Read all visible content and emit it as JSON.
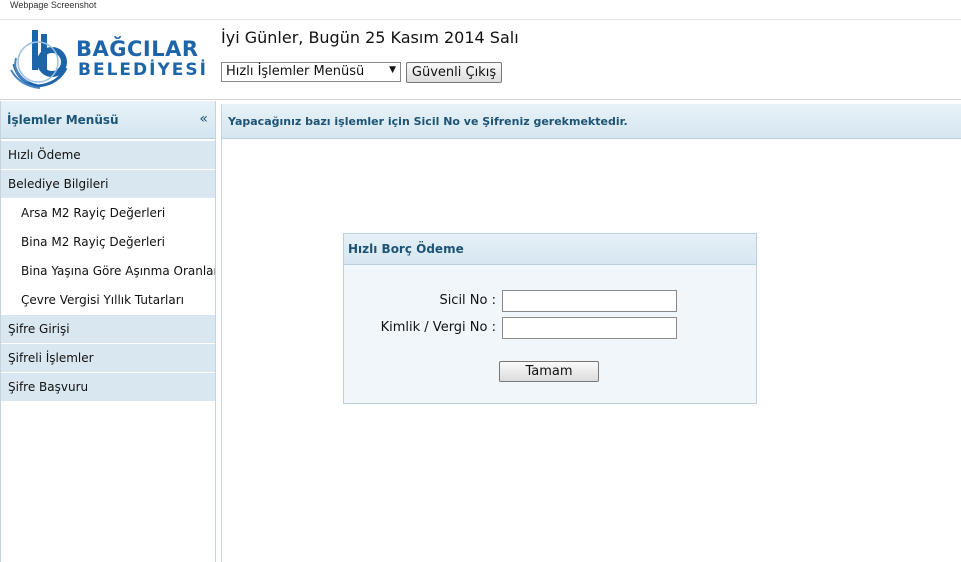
{
  "page": {
    "caption": "Webpage Screenshot"
  },
  "header": {
    "logo_line1": "BAĞCILAR",
    "logo_line2": "BELEDİYESİ",
    "greeting": "İyi Günler, Bugün 25 Kasım 2014 Salı",
    "menu_select": "Hızlı İşlemler Menüsü",
    "logout_label": "Güvenli Çıkış"
  },
  "sidebar": {
    "title": "İşlemler Menüsü",
    "collapse_glyph": "«",
    "items": [
      {
        "label": "Hızlı Ödeme",
        "level": "top"
      },
      {
        "label": "Belediye Bilgileri",
        "level": "top"
      },
      {
        "label": "Arsa M2 Rayiç Değerleri",
        "level": "sub"
      },
      {
        "label": "Bina M2 Rayiç Değerleri",
        "level": "sub"
      },
      {
        "label": "Bina Yaşına Göre Aşınma Oranları",
        "level": "sub"
      },
      {
        "label": "Çevre Vergisi Yıllık Tutarları",
        "level": "sub"
      },
      {
        "label": "Şifre Girişi",
        "level": "top"
      },
      {
        "label": "Şifreli İşlemler",
        "level": "top"
      },
      {
        "label": "Şifre Başvuru",
        "level": "top"
      }
    ]
  },
  "main": {
    "notice": "Yapacağınız bazı işlemler için Sicil No ve Şifreniz gerekmektedir."
  },
  "form": {
    "title": "Hızlı Borç Ödeme",
    "sicil_label": "Sicil No :",
    "sicil_value": "",
    "kimlik_label": "Kimlik / Vergi No :",
    "kimlik_value": "",
    "submit_label": "Tamam"
  },
  "colors": {
    "brand": "#1e64a8",
    "header_text": "#1d5476",
    "panel_bg": "#f0f6fa",
    "menu_bg": "#d9e8f0"
  }
}
